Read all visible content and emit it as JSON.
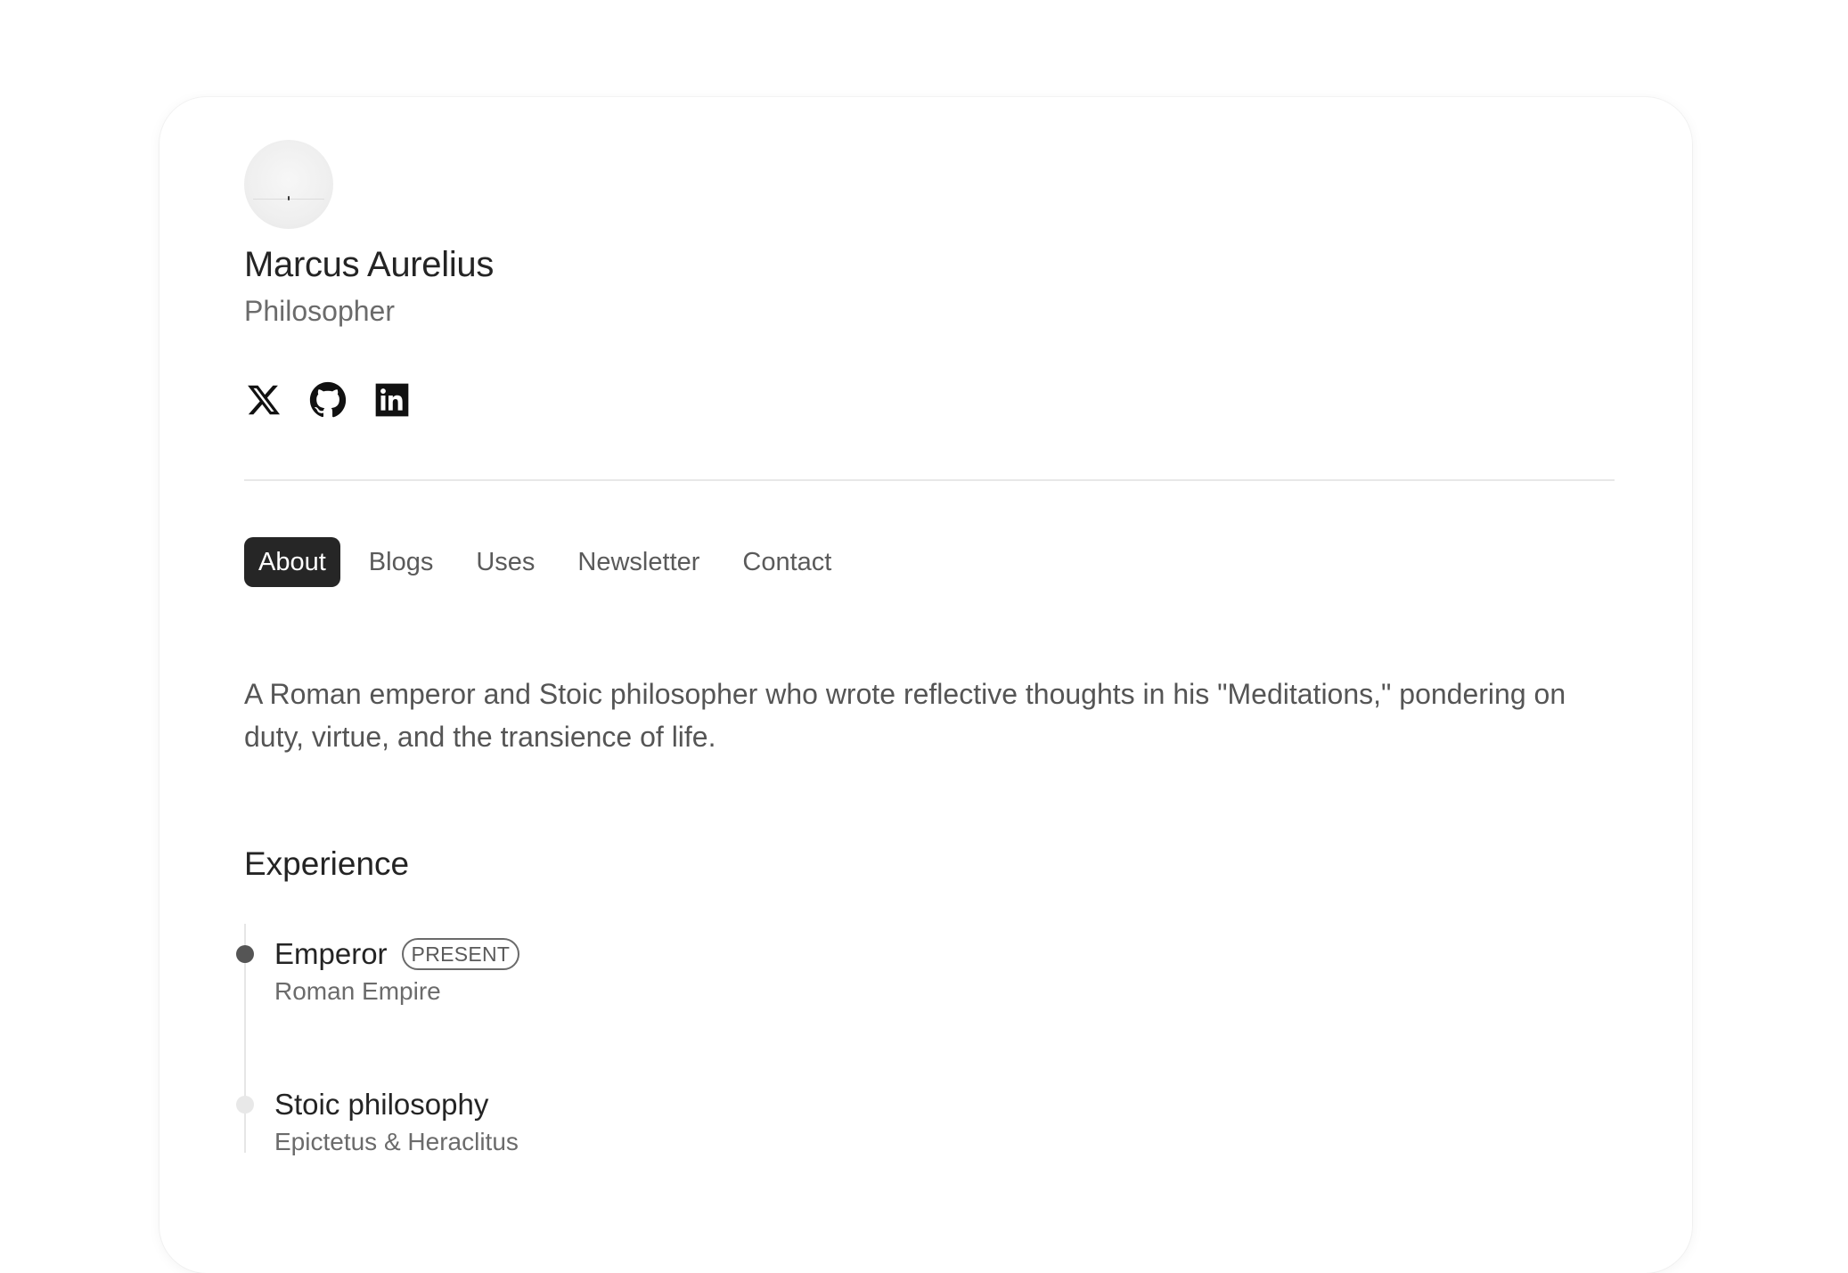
{
  "profile": {
    "name": "Marcus Aurelius",
    "role": "Philosopher"
  },
  "socials": [
    {
      "icon": "x-icon"
    },
    {
      "icon": "github-icon"
    },
    {
      "icon": "linkedin-icon"
    }
  ],
  "tabs": [
    {
      "label": "About",
      "active": true
    },
    {
      "label": "Blogs",
      "active": false
    },
    {
      "label": "Uses",
      "active": false
    },
    {
      "label": "Newsletter",
      "active": false
    },
    {
      "label": "Contact",
      "active": false
    }
  ],
  "about": {
    "bio": "A Roman emperor and Stoic philosopher who wrote reflective thoughts in his \"Meditations,\" pondering on duty, virtue, and the transience of life."
  },
  "experience": {
    "title": "Experience",
    "items": [
      {
        "title": "Emperor",
        "badge": "PRESENT",
        "subtitle": "Roman Empire",
        "dot_color": "#555555"
      },
      {
        "title": "Stoic philosophy",
        "badge": "",
        "subtitle": "Epictetus & Heraclitus",
        "dot_color": "#e8e8e8"
      }
    ]
  },
  "colors": {
    "active_tab_bg": "#262626",
    "text_primary": "#242424",
    "text_secondary": "#6b6b6b"
  }
}
